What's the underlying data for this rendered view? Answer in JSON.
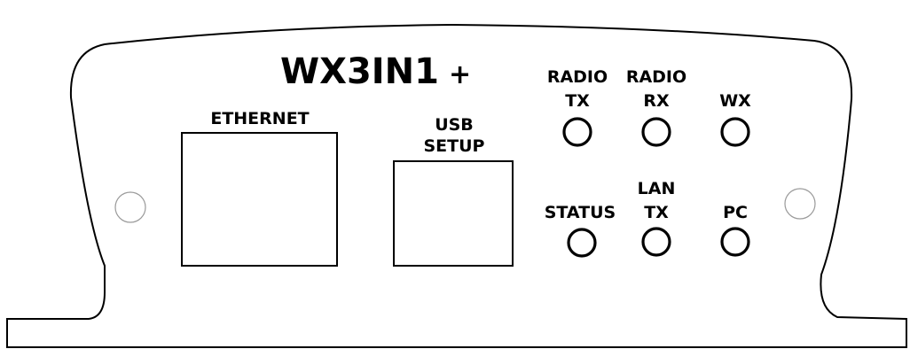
{
  "device": {
    "model": "WX3IN1",
    "model_suffix": "+"
  },
  "ports": {
    "ethernet_label": "ETHERNET",
    "usb_label_line1": "USB",
    "usb_label_line2": "SETUP"
  },
  "leds": {
    "radio_tx_line1": "RADIO",
    "radio_tx_line2": "TX",
    "radio_rx_line1": "RADIO",
    "radio_rx_line2": "RX",
    "wx": "WX",
    "status": "STATUS",
    "lan_tx_line1": "LAN",
    "lan_tx_line2": "TX",
    "pc": "PC"
  }
}
